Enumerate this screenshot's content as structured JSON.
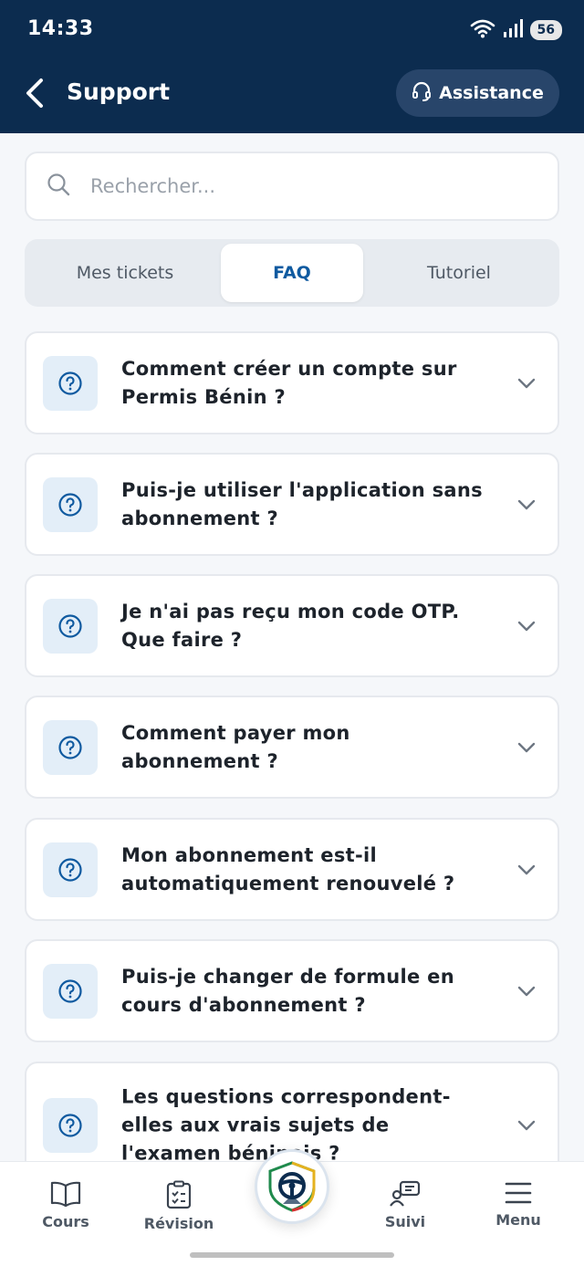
{
  "status": {
    "time": "14:33",
    "battery": "56"
  },
  "header": {
    "title": "Support",
    "assistance_label": "Assistance"
  },
  "search": {
    "placeholder": "Rechercher..."
  },
  "tabs": [
    {
      "label": "Mes tickets",
      "active": false
    },
    {
      "label": "FAQ",
      "active": true
    },
    {
      "label": "Tutoriel",
      "active": false
    }
  ],
  "faq": [
    {
      "question": "Comment créer un compte sur Permis Bénin ?"
    },
    {
      "question": "Puis-je utiliser l'application sans abonnement ?"
    },
    {
      "question": "Je n'ai pas reçu mon code OTP. Que faire ?"
    },
    {
      "question": "Comment payer mon abonnement ?"
    },
    {
      "question": "Mon abonnement est-il automatiquement renouvelé ?"
    },
    {
      "question": "Puis-je changer de formule en cours d'abonnement ?"
    },
    {
      "question": "Les questions correspondent-elles aux vrais sujets de l'examen béninois ?"
    }
  ],
  "nav": {
    "cours": "Cours",
    "revision": "Révision",
    "suivi": "Suivi",
    "menu": "Menu"
  },
  "colors": {
    "header_bg": "#0c2c4f",
    "accent": "#0f5aa0",
    "icon_bg": "#e3eef8"
  }
}
